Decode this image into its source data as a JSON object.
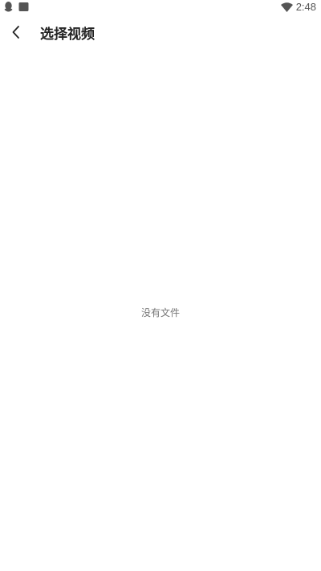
{
  "status_bar": {
    "time": "2:48",
    "left_icons": [
      "qq-icon",
      "notification-square-icon"
    ],
    "right_icons": [
      "wifi-icon"
    ]
  },
  "app_bar": {
    "back_icon": "chevron-left-icon",
    "title": "选择视频"
  },
  "content": {
    "empty_message": "没有文件"
  },
  "colors": {
    "background": "#ffffff",
    "title_text": "#222222",
    "secondary_text": "#777777",
    "status_icons": "#555555"
  }
}
